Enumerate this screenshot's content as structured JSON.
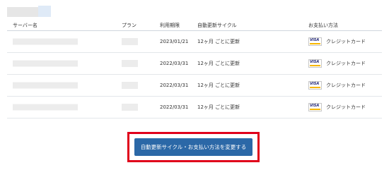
{
  "table": {
    "headers": {
      "server_name": "サーバー名",
      "plan": "プラン",
      "period": "利用期限",
      "cycle": "自動更新サイクル",
      "payment": "お支払い方法"
    },
    "rows": [
      {
        "date": "2023/01/21",
        "cycle": "12ヶ月 ごとに更新",
        "payment": "クレジットカード",
        "card_brand": "VISA"
      },
      {
        "date": "2022/03/31",
        "cycle": "12ヶ月 ごとに更新",
        "payment": "クレジットカード",
        "card_brand": "VISA"
      },
      {
        "date": "2022/03/31",
        "cycle": "12ヶ月 ごとに更新",
        "payment": "クレジットカード",
        "card_brand": "VISA"
      },
      {
        "date": "2022/03/31",
        "cycle": "12ヶ月 ごとに更新",
        "payment": "クレジットカード",
        "card_brand": "VISA"
      }
    ]
  },
  "change_button": {
    "label": "自動更新サイクル・お支払い方法を変更する"
  },
  "colors": {
    "button": "#2b68a7",
    "highlight": "#e0001b",
    "visa_bar": "#f7b600"
  }
}
